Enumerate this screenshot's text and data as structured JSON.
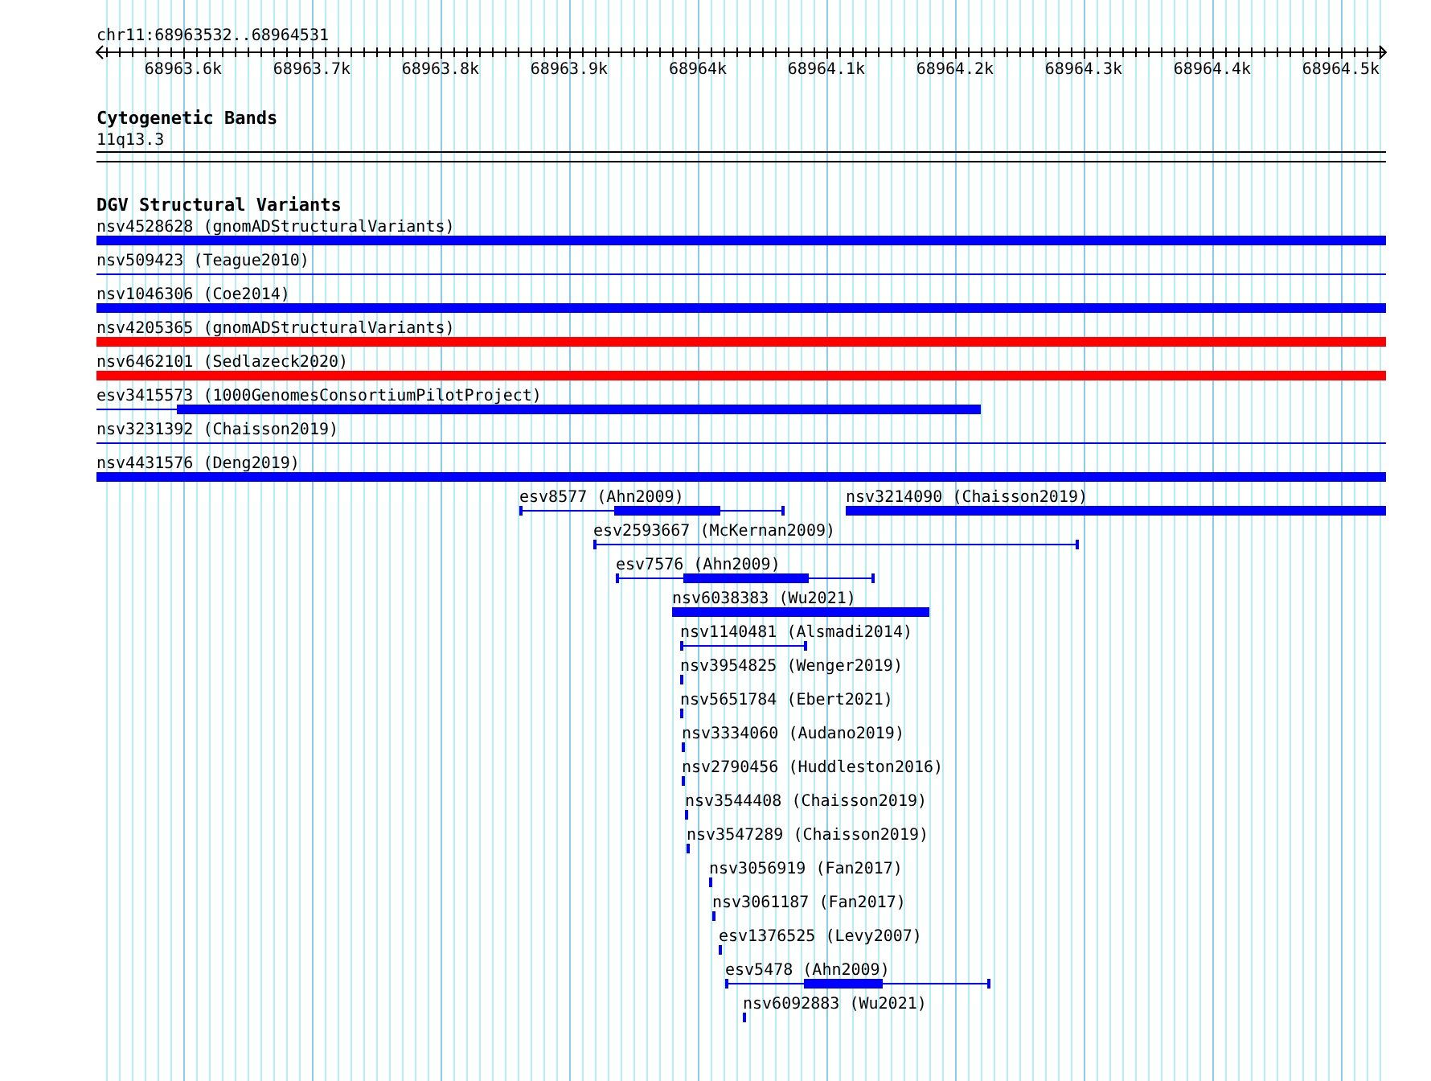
{
  "ruler": {
    "location": "chr11:68963532..68964531",
    "ticks": [
      {
        "label": "68963.6k"
      },
      {
        "label": "68963.7k"
      },
      {
        "label": "68963.8k"
      },
      {
        "label": "68963.9k"
      },
      {
        "label": "68964k"
      },
      {
        "label": "68964.1k"
      },
      {
        "label": "68964.2k"
      },
      {
        "label": "68964.3k"
      },
      {
        "label": "68964.4k"
      },
      {
        "label": "68964.5k"
      }
    ]
  },
  "tracks": [
    {
      "title": "Cytogenetic Bands",
      "kind": "bands",
      "bands": [
        {
          "label": "11q13.3"
        }
      ]
    },
    {
      "title": "DGV Structural Variants",
      "kind": "features",
      "rows": [
        {
          "features": [
            {
              "label": "nsv4528628 (gnomADStructuralVariants)",
              "kind": "block",
              "color": "#0000ff"
            }
          ]
        },
        {
          "features": [
            {
              "label": "nsv509423 (Teague2010)",
              "kind": "span",
              "color": "#0000ff"
            }
          ]
        },
        {
          "features": [
            {
              "label": "nsv1046306 (Coe2014)",
              "kind": "block",
              "color": "#0000ff"
            }
          ]
        },
        {
          "features": [
            {
              "label": "nsv4205365 (gnomADStructuralVariants)",
              "kind": "block",
              "color": "#ff0000"
            }
          ]
        },
        {
          "features": [
            {
              "label": "nsv6462101 (Sedlazeck2020)",
              "kind": "block",
              "color": "#ff0000"
            }
          ]
        },
        {
          "features": [
            {
              "label": "esv3415573 (1000GenomesConsortiumPilotProject)",
              "kind": "span",
              "color": "#0000ff"
            }
          ]
        },
        {
          "features": [
            {
              "label": "nsv3231392 (Chaisson2019)",
              "kind": "span",
              "color": "#0000ff"
            }
          ]
        },
        {
          "features": [
            {
              "label": "nsv4431576 (Deng2019)",
              "kind": "block",
              "color": "#0000ff"
            }
          ]
        },
        {
          "features": [
            {
              "label": "esv8577 (Ahn2009)",
              "kind": "span",
              "color": "#0000ff"
            },
            {
              "label": "nsv3214090 (Chaisson2019)",
              "kind": "block",
              "color": "#0000ff"
            }
          ]
        },
        {
          "features": [
            {
              "label": "esv2593667 (McKernan2009)",
              "kind": "span",
              "color": "#0000ff"
            }
          ]
        },
        {
          "features": [
            {
              "label": "esv7576 (Ahn2009)",
              "kind": "span",
              "color": "#0000ff"
            }
          ]
        },
        {
          "features": [
            {
              "label": "nsv6038383 (Wu2021)",
              "kind": "block",
              "color": "#0000ff"
            }
          ]
        },
        {
          "features": [
            {
              "label": "nsv1140481 (Alsmadi2014)",
              "kind": "span",
              "color": "#0000ff"
            }
          ]
        },
        {
          "features": [
            {
              "label": "nsv3954825 (Wenger2019)",
              "kind": "block",
              "color": "#0000ff"
            }
          ]
        },
        {
          "features": [
            {
              "label": "nsv5651784 (Ebert2021)",
              "kind": "block",
              "color": "#0000ff"
            }
          ]
        },
        {
          "features": [
            {
              "label": "nsv3334060 (Audano2019)",
              "kind": "block",
              "color": "#0000ff"
            }
          ]
        },
        {
          "features": [
            {
              "label": "nsv2790456 (Huddleston2016)",
              "kind": "block",
              "color": "#0000ff"
            }
          ]
        },
        {
          "features": [
            {
              "label": "nsv3544408 (Chaisson2019)",
              "kind": "block",
              "color": "#0000ff"
            }
          ]
        },
        {
          "features": [
            {
              "label": "nsv3547289 (Chaisson2019)",
              "kind": "block",
              "color": "#0000ff"
            }
          ]
        },
        {
          "features": [
            {
              "label": "nsv3056919 (Fan2017)",
              "kind": "block",
              "color": "#0000ff"
            }
          ]
        },
        {
          "features": [
            {
              "label": "nsv3061187 (Fan2017)",
              "kind": "block",
              "color": "#0000ff"
            }
          ]
        },
        {
          "features": [
            {
              "label": "esv1376525 (Levy2007)",
              "kind": "block",
              "color": "#0000ff"
            }
          ]
        },
        {
          "features": [
            {
              "label": "esv5478 (Ahn2009)",
              "kind": "span",
              "color": "#0000ff"
            }
          ]
        },
        {
          "features": [
            {
              "label": "nsv6092883 (Wu2021)",
              "kind": "block",
              "color": "#0000ff"
            }
          ]
        }
      ]
    }
  ]
}
